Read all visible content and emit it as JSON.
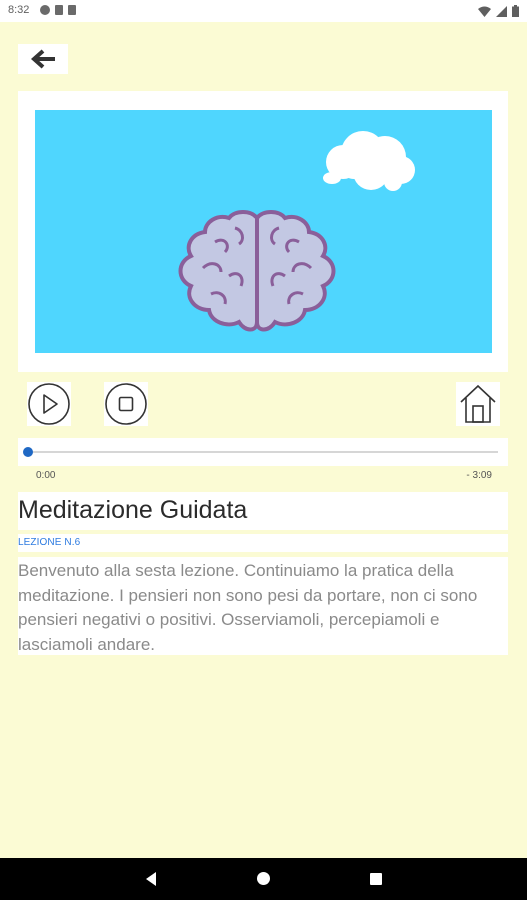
{
  "status_bar": {
    "time": "8:32",
    "left_icons": [
      "notification-dot-icon",
      "notification-square-icon",
      "sim-card-icon"
    ],
    "right_icons": [
      "wifi-icon",
      "signal-icon",
      "battery-icon"
    ]
  },
  "header": {
    "back_icon": "arrow-left-icon"
  },
  "media": {
    "illustration": "brain-with-thought-cloud",
    "background_color": "#4fd6fe"
  },
  "controls": {
    "play_icon": "play-icon",
    "stop_icon": "stop-icon",
    "home_icon": "home-icon"
  },
  "player": {
    "progress": 0,
    "elapsed": "0:00",
    "remaining": "- 3:09",
    "accent": "#1f68c4"
  },
  "lesson": {
    "title": "Meditazione Guidata",
    "label": "LEZIONE N.6",
    "description": "Benvenuto alla sesta lezione. Continuiamo la pratica della meditazione. I pensieri non sono pesi da portare, non ci sono pensieri negativi o positivi. Osserviamoli, percepiamoli e lasciamoli andare."
  },
  "nav_bar": {
    "icons": [
      "nav-back-icon",
      "nav-home-icon",
      "nav-recents-icon"
    ]
  }
}
